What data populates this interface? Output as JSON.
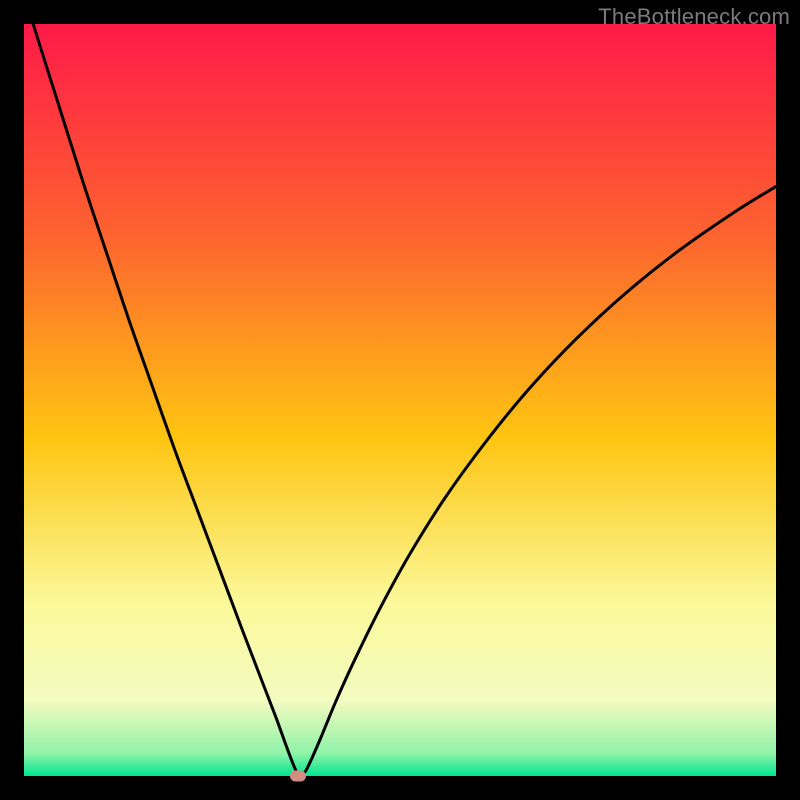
{
  "watermark": "TheBottleneck.com",
  "colors": {
    "top": "#fe1a48",
    "mid_upper": "#fd8f2c",
    "mid": "#fedc05",
    "mid_lower": "#fcfb9e",
    "bottom": "#00e590",
    "curve": "#000000",
    "marker": "#d38b82",
    "frame": "#000000"
  },
  "chart_data": {
    "type": "line",
    "title": "",
    "xlabel": "",
    "ylabel": "",
    "xlim": [
      0,
      100
    ],
    "ylim": [
      0,
      100
    ],
    "annotations": [
      {
        "text": "TheBottleneck.com",
        "position": "top-right"
      }
    ],
    "marker": {
      "x": 36.5,
      "y": 0,
      "shape": "rounded-rect"
    },
    "gradient_stops": [
      {
        "pct": 0,
        "color": "#fe1a48"
      },
      {
        "pct": 28,
        "color": "#fd632f"
      },
      {
        "pct": 55,
        "color": "#fec511"
      },
      {
        "pct": 77,
        "color": "#fbf99a"
      },
      {
        "pct": 90,
        "color": "#f3fbc0"
      },
      {
        "pct": 97,
        "color": "#8ff3a8"
      },
      {
        "pct": 100,
        "color": "#00e590"
      }
    ],
    "series": [
      {
        "name": "bottleneck-curve",
        "x": [
          0,
          2,
          5,
          8,
          11,
          14,
          17,
          20,
          23,
          26,
          29,
          31.5,
          33.5,
          34.8,
          35.7,
          36.3,
          36.5,
          37.4,
          38.3,
          39.6,
          41.5,
          44,
          47.3,
          51.3,
          56,
          61.3,
          67,
          73.3,
          80,
          87,
          94.5,
          100
        ],
        "values": [
          104,
          97.5,
          88,
          78.5,
          69.5,
          60.5,
          52,
          43.5,
          35.5,
          27.5,
          19.5,
          13,
          7.8,
          4.2,
          1.8,
          0.4,
          0,
          0.6,
          2.4,
          5.4,
          10,
          15.5,
          22.2,
          29.5,
          37,
          44.3,
          51.3,
          58,
          64.2,
          69.8,
          75,
          78.4
        ]
      }
    ]
  }
}
